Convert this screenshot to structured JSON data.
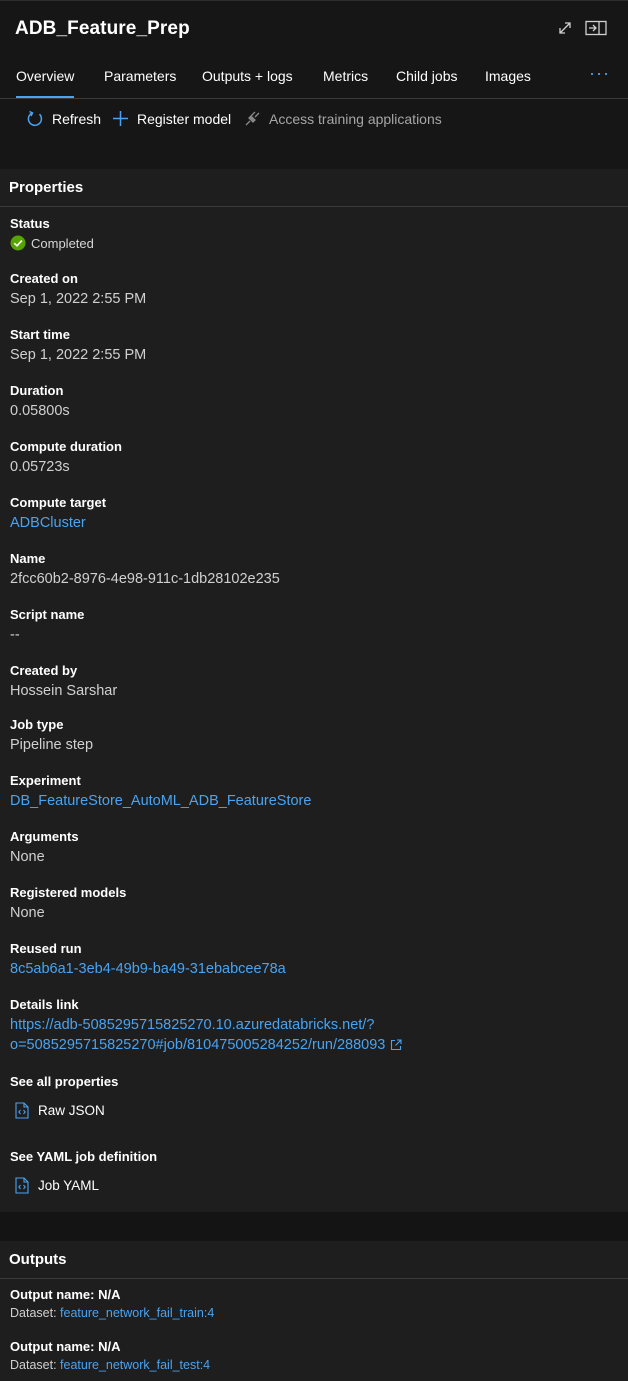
{
  "header": {
    "title": "ADB_Feature_Prep",
    "expand_icon": "expand-icon",
    "close_panel_icon": "close-panel-icon"
  },
  "tabs": [
    {
      "label": "Overview",
      "active": true
    },
    {
      "label": "Parameters"
    },
    {
      "label": "Outputs + logs"
    },
    {
      "label": "Metrics"
    },
    {
      "label": "Child jobs"
    },
    {
      "label": "Images"
    }
  ],
  "tabs_more": "···",
  "toolbar": {
    "refresh_label": "Refresh",
    "register_label": "Register model",
    "access_label": "Access training applications"
  },
  "properties": {
    "title": "Properties",
    "status_label": "Status",
    "status_value": "Completed",
    "created_on_label": "Created on",
    "created_on_value": "Sep 1, 2022 2:55 PM",
    "start_time_label": "Start time",
    "start_time_value": "Sep 1, 2022 2:55 PM",
    "duration_label": "Duration",
    "duration_value": "0.05800s",
    "compute_duration_label": "Compute duration",
    "compute_duration_value": "0.05723s",
    "compute_target_label": "Compute target",
    "compute_target_value": "ADBCluster",
    "name_label": "Name",
    "name_value": "2fcc60b2-8976-4e98-911c-1db28102e235",
    "script_name_label": "Script name",
    "script_name_value": "--",
    "created_by_label": "Created by",
    "created_by_value": "Hossein Sarshar",
    "job_type_label": "Job type",
    "job_type_value": "Pipeline step",
    "experiment_label": "Experiment",
    "experiment_value": "DB_FeatureStore_AutoML_ADB_FeatureStore",
    "arguments_label": "Arguments",
    "arguments_value": "None",
    "registered_models_label": "Registered models",
    "registered_models_value": "None",
    "reused_run_label": "Reused run",
    "reused_run_value": "8c5ab6a1-3eb4-49b9-ba49-31ebabcee78a",
    "details_link_label": "Details link",
    "details_link_line1": "https://adb-5085295715825270.10.azuredatabricks.net/?",
    "details_link_line2": "o=5085295715825270#job/810475005284252/run/288093",
    "see_all_label": "See all properties",
    "raw_json_label": "Raw JSON",
    "yaml_label": "See YAML job definition",
    "job_yaml_label": "Job YAML"
  },
  "outputs": {
    "title": "Outputs",
    "items": [
      {
        "name_label": "Output name: N/A",
        "dataset_prefix": "Dataset: ",
        "dataset": "feature_network_fail_train:4"
      },
      {
        "name_label": "Output name: N/A",
        "dataset_prefix": "Dataset: ",
        "dataset": "feature_network_fail_test:4"
      }
    ]
  },
  "colors": {
    "accent": "#4aa3f0",
    "success": "#57a300",
    "panel_bg": "#1e1e1e",
    "page_bg": "#141414"
  }
}
